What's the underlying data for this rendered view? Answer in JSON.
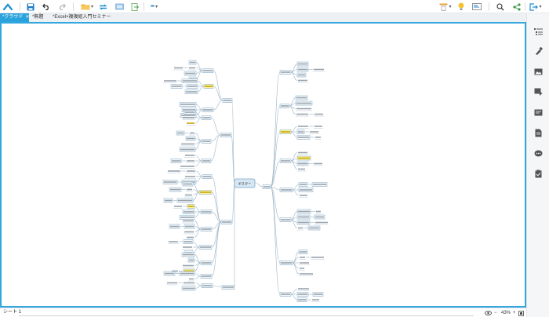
{
  "toolbar": {
    "icons": [
      "home-up-icon",
      "save-icon",
      "undo-icon",
      "redo-icon",
      "folder-icon",
      "sync-icon",
      "presentation-icon",
      "export-icon",
      "more-icon",
      "outline-icon",
      "idea-icon",
      "slides-icon",
      "search-icon",
      "share-icon",
      "exit-icon"
    ],
    "more_label": "•••"
  },
  "tabs": [
    {
      "label": "*クラウド",
      "active": true,
      "close": "✕"
    },
    {
      "label": "*無題",
      "active": false
    },
    {
      "label": "*Excel×複複組入門セミナー",
      "active": false
    }
  ],
  "mindmap": {
    "central_topic": "ポスター",
    "colors": {
      "line": "#9fb6c8",
      "node_border": "#7fa9c6",
      "central_fill": "#d6e6f3",
      "highlight": "#fff3a0",
      "accent": "#2aa3dc"
    }
  },
  "right_panel": {
    "icons": [
      "outline-list-icon",
      "format-brush-icon",
      "image-icon",
      "flag-marker-icon",
      "note-icon",
      "document-icon",
      "comment-icon",
      "task-icon"
    ]
  },
  "status": {
    "sheet_label": "シート 1",
    "zoom_label": "43%",
    "zoom_out": "−",
    "zoom_in": "+"
  }
}
